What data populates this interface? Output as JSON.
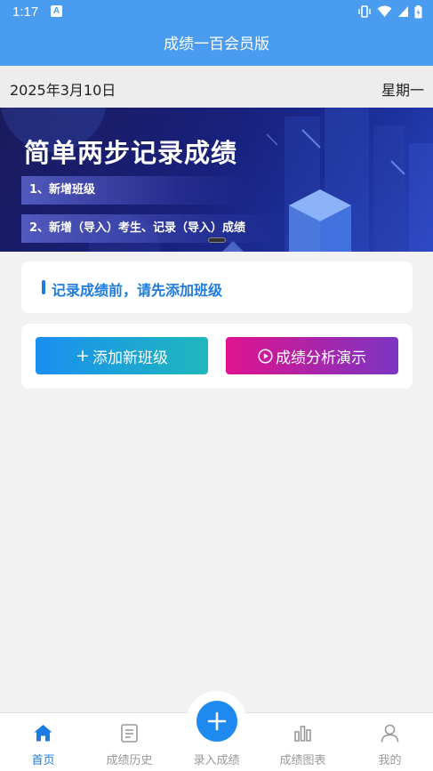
{
  "status_bar": {
    "time": "1:17",
    "app_badge": "A"
  },
  "header": {
    "title": "成绩一百会员版"
  },
  "date_bar": {
    "date": "2025年3月10日",
    "weekday": "星期一"
  },
  "banner": {
    "title": "简单两步记录成绩",
    "step1": "1、新增班级",
    "step2": "2、新增（导入）考生、记录（导入）成绩"
  },
  "notice": {
    "text": "记录成绩前，请先添加班级"
  },
  "actions": {
    "add_class_label": "添加新班级",
    "demo_label": "成绩分析演示"
  },
  "tabbar": {
    "active": "home",
    "items": [
      {
        "label": "首页",
        "icon": "home-icon"
      },
      {
        "label": "成绩历史",
        "icon": "history-icon"
      },
      {
        "label": "录入成绩",
        "icon": "plus-icon"
      },
      {
        "label": "成绩图表",
        "icon": "chart-icon"
      },
      {
        "label": "我的",
        "icon": "user-icon"
      }
    ]
  },
  "colors": {
    "primary": "#4a9cf0",
    "accent": "#1e7be0",
    "add_button_gradient": [
      "#1a8ff0",
      "#1fb7bd"
    ],
    "demo_button_gradient": [
      "#e0138f",
      "#7a35c2"
    ]
  }
}
